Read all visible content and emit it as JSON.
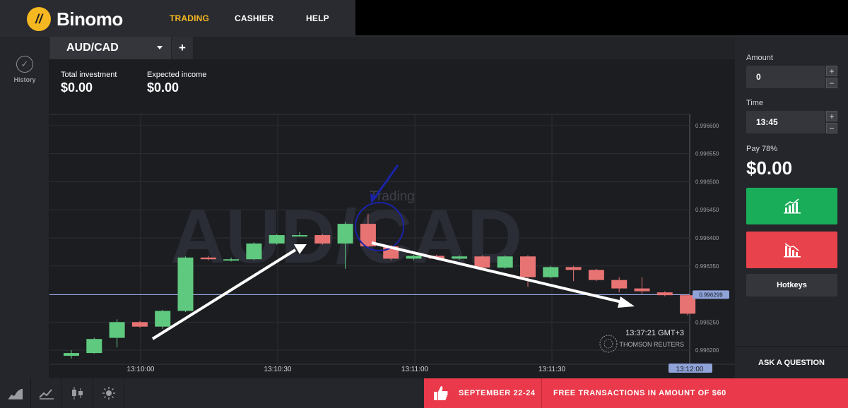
{
  "brand": {
    "logo_text": "Binomo",
    "accent": "#f6b821"
  },
  "nav": {
    "items": [
      "TRADING",
      "CASHIER",
      "HELP"
    ],
    "active": "TRADING"
  },
  "sidebar": {
    "history_label": "History"
  },
  "asset_tab": {
    "label": "AUD/CAD",
    "add_label": "+"
  },
  "investment": {
    "total_label": "Total investment",
    "total_value": "$0.00",
    "expected_label": "Expected income",
    "expected_value": "$0.00"
  },
  "chart_data": {
    "type": "candlestick",
    "watermark": "AUD/CAD",
    "annotation": "Trading",
    "current_price": "0.996299",
    "price_ticks": [
      "0.996600",
      "0.996550",
      "0.996500",
      "0.996450",
      "0.996400",
      "0.996350",
      "0.996250",
      "0.996200"
    ],
    "time_ticks": [
      "13:10:00",
      "13:10:30",
      "13:11:00",
      "13:11:30",
      "13:12:00"
    ],
    "ylim": [
      0.996175,
      0.99662
    ],
    "candles": [
      {
        "o": 0.996195,
        "c": 0.99619,
        "h": 0.9962,
        "l": 0.996185,
        "dir": "up"
      },
      {
        "o": 0.996195,
        "c": 0.99622,
        "h": 0.996222,
        "l": 0.996194,
        "dir": "up"
      },
      {
        "o": 0.996222,
        "c": 0.99625,
        "h": 0.996255,
        "l": 0.996205,
        "dir": "up"
      },
      {
        "o": 0.99625,
        "c": 0.996242,
        "h": 0.996252,
        "l": 0.99624,
        "dir": "down"
      },
      {
        "o": 0.996242,
        "c": 0.99627,
        "h": 0.996272,
        "l": 0.996238,
        "dir": "up"
      },
      {
        "o": 0.99627,
        "c": 0.996365,
        "h": 0.996367,
        "l": 0.996268,
        "dir": "up"
      },
      {
        "o": 0.996365,
        "c": 0.996362,
        "h": 0.996368,
        "l": 0.99636,
        "dir": "down"
      },
      {
        "o": 0.996362,
        "c": 0.99636,
        "h": 0.996365,
        "l": 0.996358,
        "dir": "up"
      },
      {
        "o": 0.996362,
        "c": 0.99639,
        "h": 0.996392,
        "l": 0.99636,
        "dir": "up"
      },
      {
        "o": 0.99639,
        "c": 0.996405,
        "h": 0.996407,
        "l": 0.996388,
        "dir": "up"
      },
      {
        "o": 0.996405,
        "c": 0.996405,
        "h": 0.99641,
        "l": 0.996402,
        "dir": "up"
      },
      {
        "o": 0.996405,
        "c": 0.99639,
        "h": 0.996407,
        "l": 0.996388,
        "dir": "down"
      },
      {
        "o": 0.99639,
        "c": 0.996425,
        "h": 0.996428,
        "l": 0.996345,
        "dir": "up"
      },
      {
        "o": 0.996425,
        "c": 0.996385,
        "h": 0.996443,
        "l": 0.996383,
        "dir": "down"
      },
      {
        "o": 0.996385,
        "c": 0.996363,
        "h": 0.996387,
        "l": 0.99636,
        "dir": "down"
      },
      {
        "o": 0.996363,
        "c": 0.996368,
        "h": 0.99637,
        "l": 0.99636,
        "dir": "up"
      },
      {
        "o": 0.996368,
        "c": 0.996363,
        "h": 0.99637,
        "l": 0.996361,
        "dir": "down"
      },
      {
        "o": 0.996363,
        "c": 0.996367,
        "h": 0.996369,
        "l": 0.996361,
        "dir": "up"
      },
      {
        "o": 0.996367,
        "c": 0.996347,
        "h": 0.996369,
        "l": 0.996345,
        "dir": "down"
      },
      {
        "o": 0.996347,
        "c": 0.996367,
        "h": 0.996369,
        "l": 0.996345,
        "dir": "up"
      },
      {
        "o": 0.996367,
        "c": 0.99633,
        "h": 0.996369,
        "l": 0.996313,
        "dir": "down"
      },
      {
        "o": 0.99633,
        "c": 0.996348,
        "h": 0.99635,
        "l": 0.996328,
        "dir": "up"
      },
      {
        "o": 0.996348,
        "c": 0.996343,
        "h": 0.99635,
        "l": 0.996323,
        "dir": "down"
      },
      {
        "o": 0.996343,
        "c": 0.996325,
        "h": 0.996345,
        "l": 0.996323,
        "dir": "down"
      },
      {
        "o": 0.996325,
        "c": 0.99631,
        "h": 0.99633,
        "l": 0.996303,
        "dir": "down"
      },
      {
        "o": 0.99631,
        "c": 0.996305,
        "h": 0.99633,
        "l": 0.9963,
        "dir": "down"
      },
      {
        "o": 0.996303,
        "c": 0.996298,
        "h": 0.996305,
        "l": 0.996296,
        "dir": "down"
      },
      {
        "o": 0.996298,
        "c": 0.996265,
        "h": 0.9963,
        "l": 0.996262,
        "dir": "down"
      }
    ],
    "grid": true,
    "up_color": "#5fca7f",
    "down_color": "#e87373"
  },
  "clock": {
    "time": "13:37:21 GMT+3",
    "provider": "THOMSON REUTERS"
  },
  "trade_panel": {
    "amount_label": "Amount",
    "amount_value": "0",
    "time_label": "Time",
    "time_value": "13:45",
    "payout_label": "Pay 78%",
    "payout_value": "$0.00",
    "plus": "+",
    "minus": "−",
    "hotkeys_label": "Hotkeys",
    "ask_label": "ASK A QUESTION",
    "up_color": "#19ad5a",
    "down_color": "#e8424c"
  },
  "bottom_icons": [
    "area-chart-icon",
    "line-chart-icon",
    "candles-icon",
    "sun-icon"
  ],
  "promo": {
    "date": "SEPTEMBER 22-24",
    "message": "FREE TRANSACTIONS IN AMOUNT OF $60",
    "color": "#e9394a"
  }
}
